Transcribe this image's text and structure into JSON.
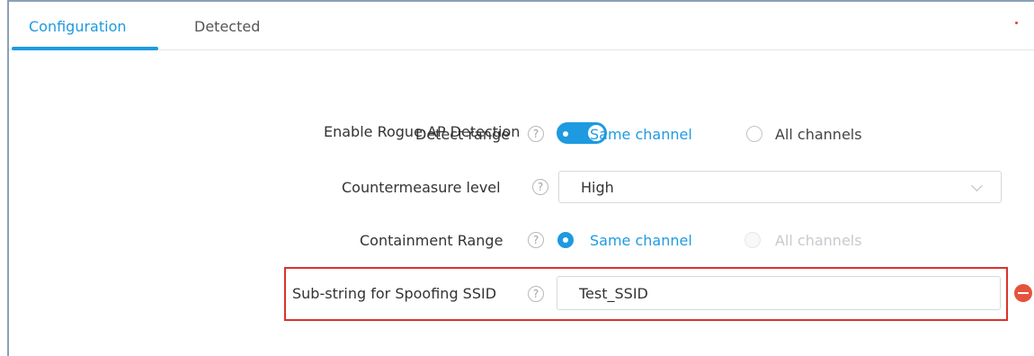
{
  "tabs": [
    {
      "label": "Configuration",
      "active": true
    },
    {
      "label": "Detected",
      "active": false
    }
  ],
  "fields": {
    "enable_rogue": {
      "label": "Enable Rogue AP Detection",
      "enabled": true
    },
    "detect_range": {
      "label": "Detect range",
      "help": "?",
      "options": [
        {
          "label": "Same channel",
          "selected": true
        },
        {
          "label": "All channels",
          "selected": false
        }
      ]
    },
    "countermeasure": {
      "label": "Countermeasure level",
      "help": "?",
      "value": "High"
    },
    "containment_range": {
      "label": "Containment Range",
      "help": "?",
      "options": [
        {
          "label": "Same channel",
          "selected": true
        },
        {
          "label": "All channels",
          "selected": false,
          "disabled": true
        }
      ]
    },
    "spoofing_ssid": {
      "label": "Sub-string for Spoofing SSID",
      "help": "?",
      "value": "Test_SSID"
    }
  },
  "colors": {
    "accent": "#1e9ae0",
    "highlight": "#d9342b",
    "remove": "#e5533d"
  }
}
